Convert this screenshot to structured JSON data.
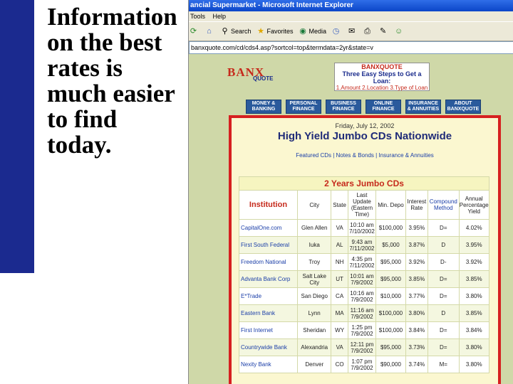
{
  "slide": {
    "text": "Information on the best rates is much easier to find today."
  },
  "browser": {
    "title": "ancial Supermarket - Microsoft Internet Explorer",
    "menu": [
      "Tools",
      "Help"
    ],
    "toolbar": {
      "search_label": "Search",
      "favorites_label": "Favorites",
      "media_label": "Media"
    },
    "address": "banxquote.com/cd/cds4.asp?sortcol=top&termdata=2yr&state=v"
  },
  "site": {
    "logo_text": "BANX",
    "logo_sub": "QUOTE",
    "steps": {
      "title": "BANXQUOTE",
      "line": "Three Easy Steps to Get a Loan:",
      "items": "1.Amount  2.Location  3.Type of Loan"
    },
    "nav": [
      "MONEY & BANKING",
      "PERSONAL FINANCE",
      "BUSINESS FINANCE",
      "ONLINE FINANCE",
      "INSURANCE & ANNUITIES",
      "ABOUT BANXQUOTE"
    ]
  },
  "content": {
    "date": "Friday, July 12, 2002",
    "title": "High Yield Jumbo CDs Nationwide",
    "sublinks": "Featured CDs | Notes & Bonds | Insurance & Annuities",
    "table_title": "2 Years Jumbo CDs",
    "columns": [
      "Institution",
      "City",
      "State",
      "Last Update (Eastern Time)",
      "Min. Depo",
      "Interest Rate",
      "Compound Method",
      "Annual Percentage Yield"
    ],
    "rows": [
      [
        "CapitalOne.com",
        "Glen Allen",
        "VA",
        "10:10 am 7/10/2002",
        "$100,000",
        "3.95%",
        "D=",
        "4.02%"
      ],
      [
        "First South Federal",
        "Iuka",
        "AL",
        "9:43 am 7/11/2002",
        "$5,000",
        "3.87%",
        "D",
        "3.95%"
      ],
      [
        "Freedom National",
        "Troy",
        "NH",
        "4:35 pm 7/11/2002",
        "$95,000",
        "3.92%",
        "D-",
        "3.92%"
      ],
      [
        "Advanta Bank Corp",
        "Salt Lake City",
        "UT",
        "10:01 am 7/9/2002",
        "$95,000",
        "3.85%",
        "D=",
        "3.85%"
      ],
      [
        "E*Trade",
        "San Diego",
        "CA",
        "10:16 am 7/9/2002",
        "$10,000",
        "3.77%",
        "D=",
        "3.80%"
      ],
      [
        "Eastern Bank",
        "Lynn",
        "MA",
        "11:16 am 7/9/2002",
        "$100,000",
        "3.80%",
        "D",
        "3.85%"
      ],
      [
        "First Internet",
        "Sheridan",
        "WY",
        "1:25 pm 7/9/2002",
        "$100,000",
        "3.84%",
        "D=",
        "3.84%"
      ],
      [
        "Countrywide Bank",
        "Alexandria",
        "VA",
        "12:11 pm 7/9/2002",
        "$95,000",
        "3.73%",
        "D=",
        "3.80%"
      ],
      [
        "Nexity Bank",
        "Denver",
        "CO",
        "1:07 pm 7/9/2002",
        "$90,000",
        "3.74%",
        "M=",
        "3.80%"
      ]
    ]
  },
  "colors": {
    "slide_bar": "#1b2a8f",
    "accent_red": "#d62020",
    "page_bg": "#cfd8a8"
  }
}
